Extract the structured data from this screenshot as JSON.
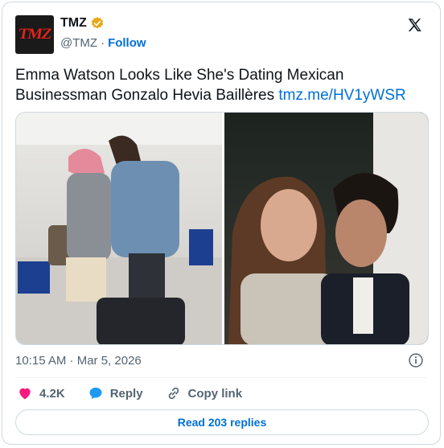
{
  "account": {
    "logo_text": "TMZ",
    "name": "TMZ",
    "handle": "@TMZ",
    "separator": "·",
    "follow_label": "Follow"
  },
  "post": {
    "text": "Emma Watson Looks Like She's Dating Mexican Businessman Gonzalo Hevia Baillères",
    "link": "tmz.me/HV1yWSR",
    "timestamp": "10:15 AM · Mar 5, 2026"
  },
  "actions": {
    "likes": "4.2K",
    "reply_label": "Reply",
    "copy_link_label": "Copy link"
  },
  "replies_button": "Read 203 replies",
  "colors": {
    "accent": "#006fd6",
    "like": "#f91880",
    "verified_badge": "#e8a817"
  }
}
